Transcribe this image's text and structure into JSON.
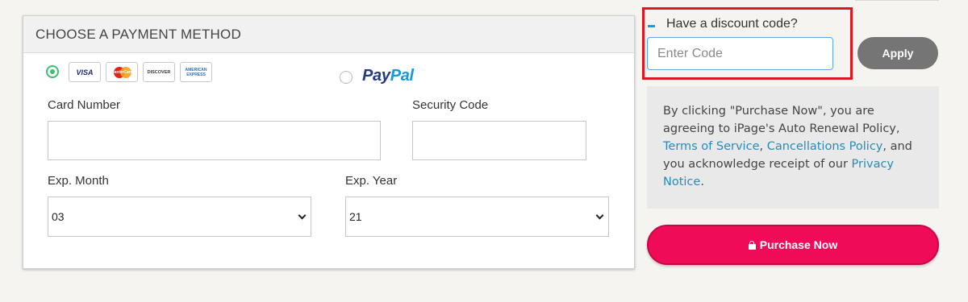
{
  "payment": {
    "header": "CHOOSE A PAYMENT METHOD",
    "methods": {
      "card": {
        "selected": true,
        "logos": [
          "VISA",
          "MasterCard",
          "DISCOVER",
          "AMERICAN EXPRESS"
        ]
      },
      "paypal": {
        "selected": false,
        "logo_part1": "Pay",
        "logo_part2": "Pal"
      }
    },
    "fields": {
      "card_number_label": "Card Number",
      "security_code_label": "Security Code",
      "exp_month_label": "Exp. Month",
      "exp_month_value": "03",
      "exp_year_label": "Exp. Year",
      "exp_year_value": "21"
    }
  },
  "discount": {
    "label": "Have a discount code?",
    "placeholder": "Enter Code",
    "apply_label": "Apply"
  },
  "policy": {
    "text_1": "By clicking \"Purchase Now\", you are agreeing to iPage's Auto Renewal Policy, ",
    "link_terms": "Terms of Service",
    "text_2": ", ",
    "link_cancellations": "Cancellations Policy",
    "text_3": ", and you acknowledge receipt of our ",
    "link_privacy": "Privacy Notice",
    "text_4": "."
  },
  "purchase": {
    "label": "Purchase Now"
  },
  "colors": {
    "brand_pink": "#ef0b58",
    "link_blue": "#2a8bb8",
    "highlight_red": "#e0161f",
    "radio_green": "#3dbf72"
  }
}
